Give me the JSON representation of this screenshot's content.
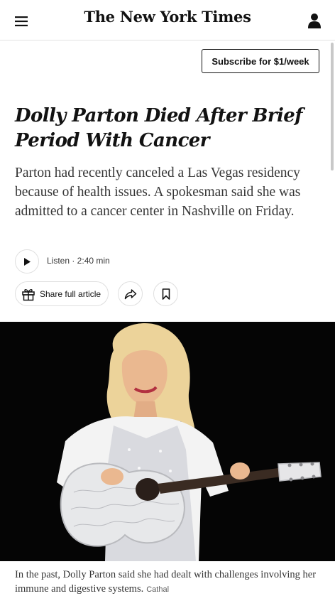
{
  "header": {
    "masthead": "The New York Times",
    "menu_icon": "hamburger-menu-icon",
    "account_icon": "user-account-icon",
    "subscribe_label": "Subscribe for $1/week"
  },
  "article": {
    "headline_line1": "Dolly Parton Died After Brief",
    "headline_line2": "Period With Cancer",
    "summary": "Parton had recently canceled a Las Vegas residency because of health issues. A spokesman said she was admitted to a cancer center in Nashville on Friday.",
    "listen_label": "Listen · 2:40 min",
    "share_label": "Share full article",
    "share_icon": "gift-icon",
    "forward_icon": "share-arrow-icon",
    "bookmark_icon": "bookmark-icon",
    "play_icon": "play-icon"
  },
  "photo": {
    "caption": "In the past, Dolly Parton said she had dealt with challenges involving her immune and digestive systems.",
    "credit": "Cathal"
  },
  "colors": {
    "text": "#121212",
    "secondary_text": "#363636",
    "border": "#dfdfdf",
    "photo_background": "#050505"
  }
}
